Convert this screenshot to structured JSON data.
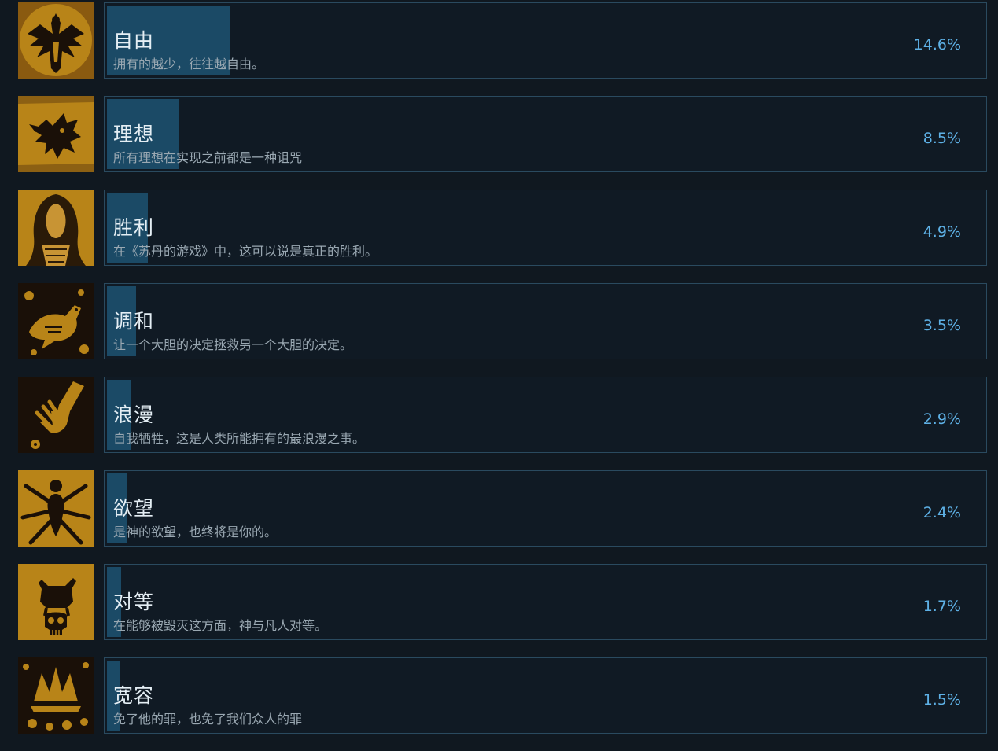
{
  "colors": {
    "background": "#101820",
    "card_border": "#2a4a5f",
    "progress_fill": "#1b4a66",
    "title_text": "#e4eef4",
    "description_text": "#9aa8b2",
    "percent_text": "#5eb1e6",
    "icon_gold": "#b88418"
  },
  "achievements": [
    {
      "title": "自由",
      "description": "拥有的越少，往往越自由。",
      "percent": "14.6%",
      "fill_fraction": 0.146,
      "icon": "winged-figure-icon"
    },
    {
      "title": "理想",
      "description": "所有理想在实现之前都是一种诅咒",
      "percent": "8.5%",
      "fill_fraction": 0.085,
      "icon": "dragon-icon"
    },
    {
      "title": "胜利",
      "description": "在《苏丹的游戏》中，这可以说是真正的胜利。",
      "percent": "4.9%",
      "fill_fraction": 0.049,
      "icon": "veiled-woman-icon"
    },
    {
      "title": "调和",
      "description": "让一个大胆的决定拯救另一个大胆的决定。",
      "percent": "3.5%",
      "fill_fraction": 0.035,
      "icon": "bird-icon"
    },
    {
      "title": "浪漫",
      "description": "自我牺牲，这是人类所能拥有的最浪漫之事。",
      "percent": "2.9%",
      "fill_fraction": 0.029,
      "icon": "hand-flower-icon"
    },
    {
      "title": "欲望",
      "description": "是神的欲望，也终将是你的。",
      "percent": "2.4%",
      "fill_fraction": 0.024,
      "icon": "many-arms-icon"
    },
    {
      "title": "对等",
      "description": "在能够被毁灭这方面，神与凡人对等。",
      "percent": "1.7%",
      "fill_fraction": 0.017,
      "icon": "goat-skull-icon"
    },
    {
      "title": "宽容",
      "description": "免了他的罪，也免了我们众人的罪",
      "percent": "1.5%",
      "fill_fraction": 0.015,
      "icon": "crown-flowers-icon"
    }
  ]
}
